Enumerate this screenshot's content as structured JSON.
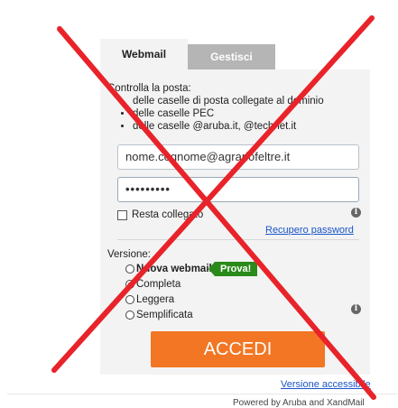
{
  "tabs": {
    "webmail": "Webmail",
    "gestisci": "Gestisci"
  },
  "intro": {
    "heading": "Controlla la posta:",
    "items": [
      "delle caselle di posta collegate al dominio",
      "delle caselle PEC",
      "delle caselle @aruba.it, @technet.it"
    ]
  },
  "form": {
    "email_value": "nome.cognome@agrariofeltre.it",
    "password_mask": "•••••••••",
    "stay_logged_label": "Resta collegato",
    "recover_link": "Recupero password",
    "info_glyph": "i"
  },
  "version": {
    "label": "Versione:",
    "options": [
      "Nuova webmail",
      "Completa",
      "Leggera",
      "Semplificata"
    ],
    "selected": "Completa",
    "badge": "Prova!"
  },
  "submit_label": "ACCEDI",
  "accessible_link": "Versione accessibile",
  "powered_by": "Powered by Aruba and XandMail",
  "colors": {
    "accent": "#f27623",
    "badge": "#2a8a1a",
    "link": "#1a55c9",
    "cross": "#e8232a"
  }
}
